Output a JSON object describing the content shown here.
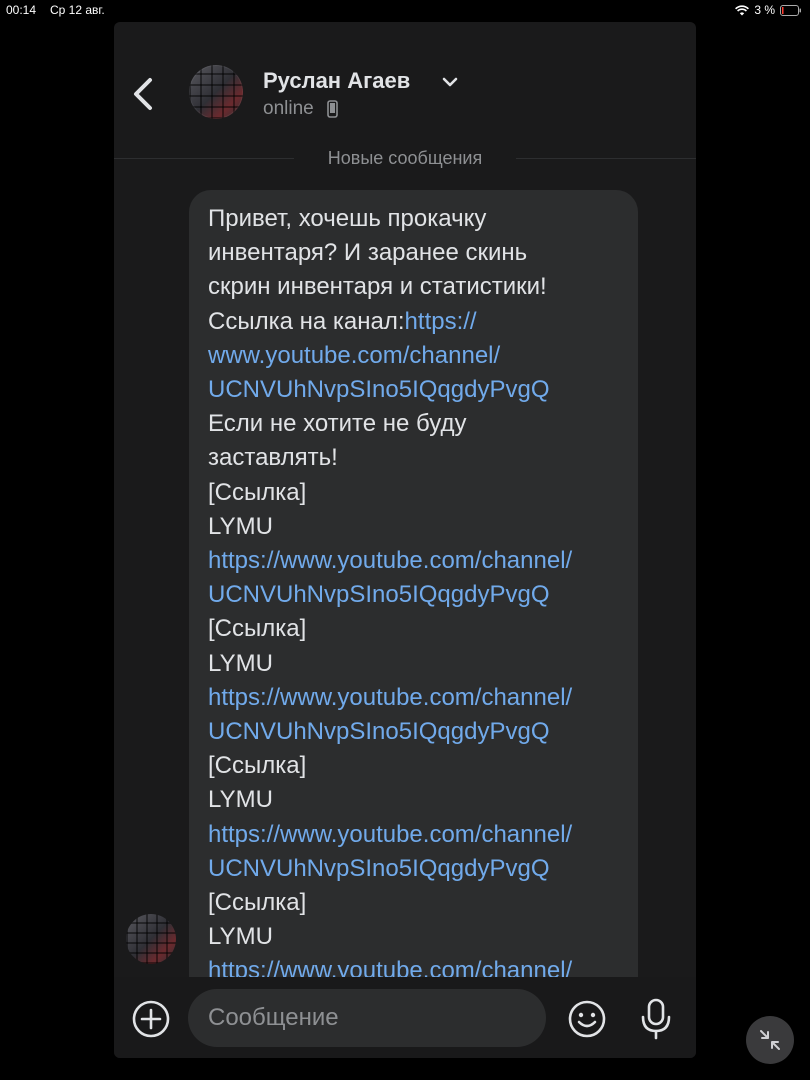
{
  "status_bar": {
    "time": "00:14",
    "date": "Ср 12 авг.",
    "battery": "3 %"
  },
  "header": {
    "contact_name": "Руслан Агаев",
    "contact_status": "online"
  },
  "divider_label": "Новые сообщения",
  "message": {
    "lines": [
      {
        "text": "Привет, хочешь прокачку",
        "link": false
      },
      {
        "text": "инвентаря? И заранее скинь",
        "link": false
      },
      {
        "text": "скрин инвентаря и статистики!",
        "link": false
      },
      {
        "text": "Ссылка на канал:",
        "link": false,
        "suffix": "https://"
      },
      {
        "text": "www.youtube.com/channel/",
        "link": true
      },
      {
        "text": "UCNVUhNvpSIno5IQqgdyPvgQ",
        "link": true
      },
      {
        "text": "Если не хотите не буду",
        "link": false
      },
      {
        "text": "заставлять!",
        "link": false
      },
      {
        "text": "[Ссылка]",
        "link": false
      },
      {
        "text": "LYMU",
        "link": false
      },
      {
        "text": "https://www.youtube.com/channel/",
        "link": true
      },
      {
        "text": "UCNVUhNvpSIno5IQqgdyPvgQ",
        "link": true
      },
      {
        "text": "[Ссылка]",
        "link": false
      },
      {
        "text": "LYMU",
        "link": false
      },
      {
        "text": "https://www.youtube.com/channel/",
        "link": true
      },
      {
        "text": "UCNVUhNvpSIno5IQqgdyPvgQ",
        "link": true
      },
      {
        "text": "[Ссылка]",
        "link": false
      },
      {
        "text": "LYMU",
        "link": false
      },
      {
        "text": "https://www.youtube.com/channel/",
        "link": true
      },
      {
        "text": "UCNVUhNvpSIno5IQqgdyPvgQ",
        "link": true
      },
      {
        "text": "[Ссылка]",
        "link": false
      },
      {
        "text": "LYMU",
        "link": false
      },
      {
        "text": "https://www.youtube.com/channel/",
        "link": true
      }
    ]
  },
  "composer": {
    "placeholder": "Сообщение"
  },
  "icons": {
    "back": "chevron-left-icon",
    "name_dropdown": "chevron-down-icon",
    "device": "phone-icon",
    "add": "plus-circle-icon",
    "emoji": "smiley-icon",
    "mic": "microphone-icon",
    "minimize": "collapse-arrows-icon",
    "wifi": "wifi-icon",
    "battery": "battery-icon"
  },
  "colors": {
    "background": "#1a1a1b",
    "bubble": "#2c2d2e",
    "link": "#71aaeb",
    "text": "#e1e3e6",
    "secondary_text": "#8e9093"
  }
}
